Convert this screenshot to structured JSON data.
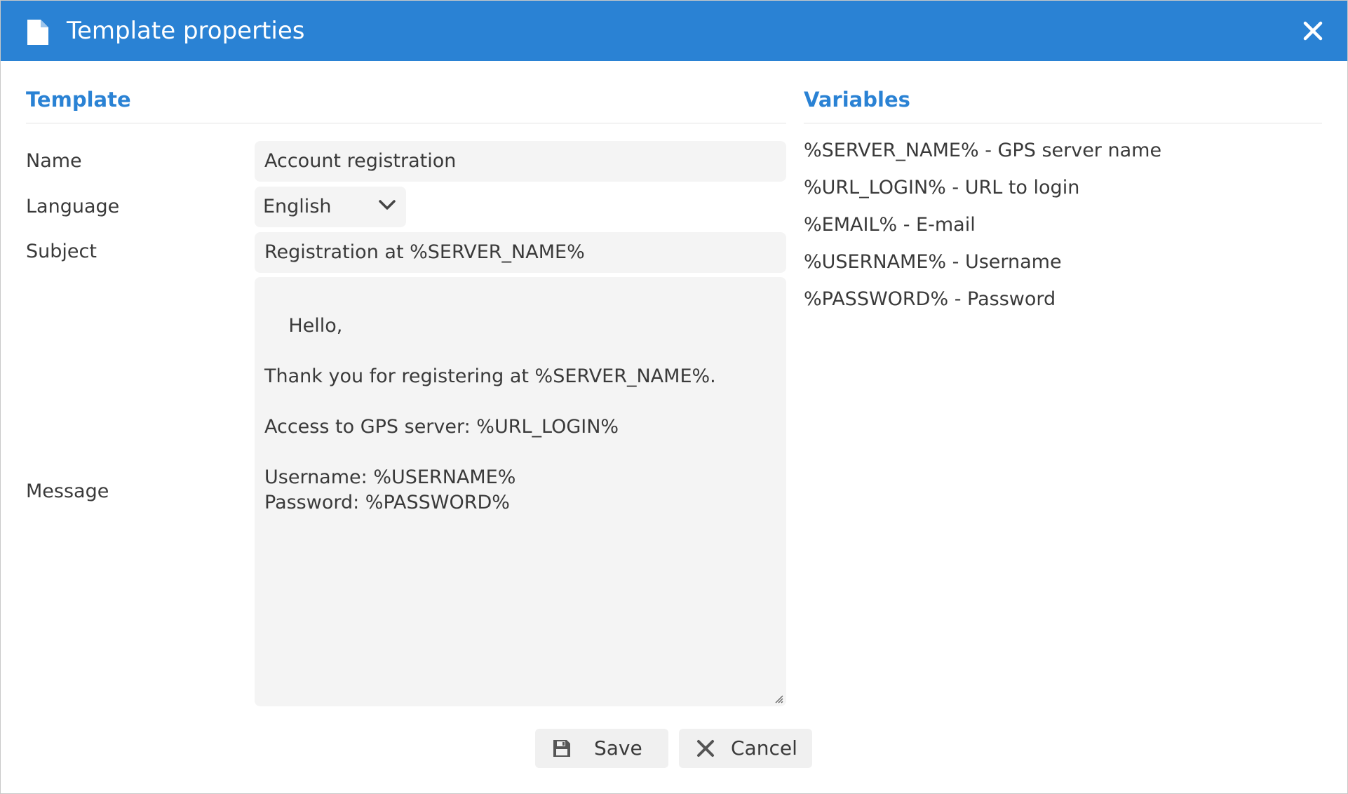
{
  "window": {
    "title": "Template properties",
    "title_icon": "document-icon",
    "close_icon": "close-icon"
  },
  "template_section": {
    "heading": "Template",
    "fields": {
      "name": {
        "label": "Name",
        "value": "Account registration"
      },
      "language": {
        "label": "Language",
        "value": "English"
      },
      "subject": {
        "label": "Subject",
        "value": "Registration at %SERVER_NAME%"
      },
      "message": {
        "label": "Message",
        "value": "Hello,\n\nThank you for registering at %SERVER_NAME%.\n\nAccess to GPS server: %URL_LOGIN%\n\nUsername: %USERNAME%\nPassword: %PASSWORD%"
      }
    }
  },
  "variables_section": {
    "heading": "Variables",
    "items": [
      "%SERVER_NAME% - GPS server name",
      "%URL_LOGIN% - URL to login",
      "%EMAIL% - E-mail",
      "%USERNAME% - Username",
      "%PASSWORD% - Password"
    ]
  },
  "buttons": {
    "save_label": "Save",
    "cancel_label": "Cancel"
  },
  "colors": {
    "accent": "#2a82d4",
    "field_bg": "#f4f4f4",
    "text": "#3a3a3a"
  }
}
